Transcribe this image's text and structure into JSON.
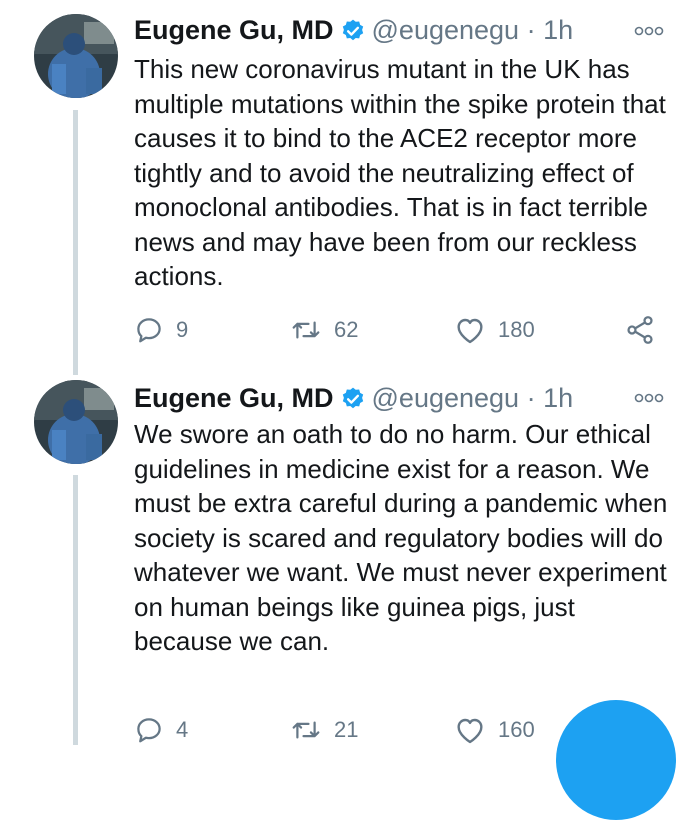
{
  "tweets": [
    {
      "author": {
        "name": "Eugene Gu, MD",
        "handle": "@eugenegu",
        "separator": "·",
        "time": "1h",
        "verified": true
      },
      "text": "This new coronavirus mutant in the UK has multiple mutations within the spike protein that causes it to bind to the ACE2 receptor more tightly and to avoid the neutralizing effect of monoclonal antibodies. That is in fact terrible news and may have been from our reckless actions.",
      "replies": "9",
      "retweets": "62",
      "likes": "180"
    },
    {
      "author": {
        "name": "Eugene Gu, MD",
        "handle": "@eugenegu",
        "separator": "·",
        "time": "1h",
        "verified": true
      },
      "text": "We swore an oath to do no harm. Our ethical guidelines in medicine exist for a reason. We must be extra careful during a pandemic when society is scared and regulatory bodies will do whatever we want. We must never experiment on human beings like guinea pigs, just because we can.",
      "replies": "4",
      "retweets": "21",
      "likes": "160"
    }
  ],
  "colors": {
    "accent": "#1da1f2",
    "text": "#14171a",
    "secondary": "#657786",
    "thread_line": "#cfd9de"
  },
  "icons": [
    "verified-badge-icon",
    "more-options-icon",
    "reply-icon",
    "retweet-icon",
    "like-icon",
    "share-icon"
  ]
}
